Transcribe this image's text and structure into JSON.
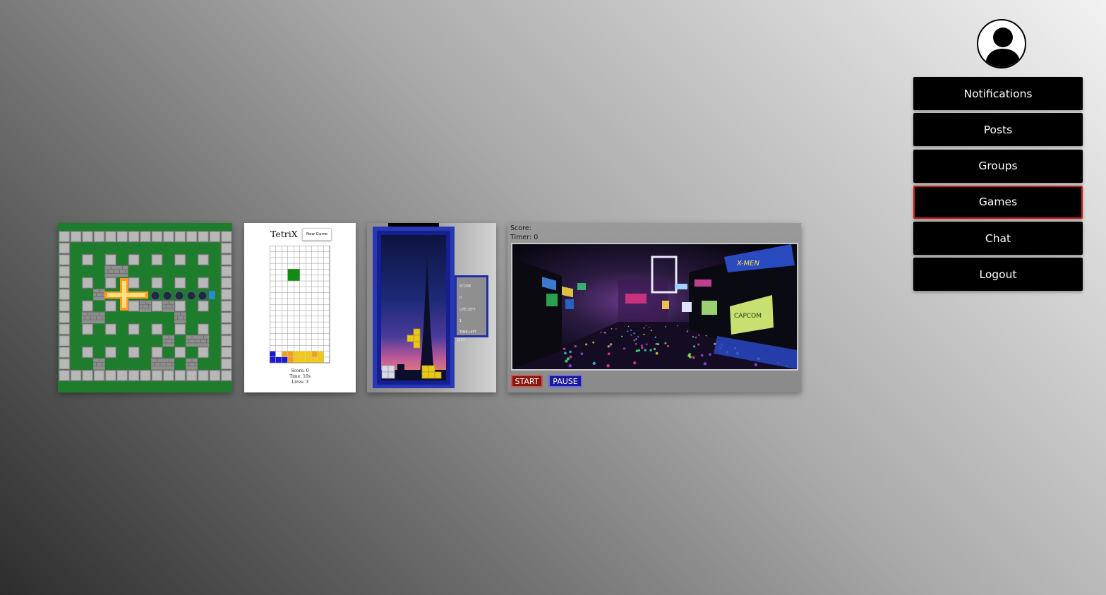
{
  "menu": {
    "items": [
      {
        "label": "Notifications",
        "name": "menu-item-notifications"
      },
      {
        "label": "Posts",
        "name": "menu-item-posts"
      },
      {
        "label": "Groups",
        "name": "menu-item-groups"
      },
      {
        "label": "Games",
        "name": "menu-item-games",
        "active": true
      },
      {
        "label": "Chat",
        "name": "menu-item-chat"
      },
      {
        "label": "Logout",
        "name": "menu-item-logout"
      }
    ],
    "active_border_color": "#d01818"
  },
  "games": {
    "tetrix": {
      "title": "TetriX",
      "new_game_label": "New Game",
      "score": "Score: 0",
      "time": "Time: 10s",
      "lives": "Lives: 3"
    },
    "skyline": {
      "score_label": "SCORE",
      "score_value": "0",
      "life_label": "LIFE LEFT",
      "life_value": "1",
      "time_label": "TIME LEFT",
      "time_value": "0:57"
    },
    "arcade": {
      "score_label": "Score:",
      "timer_label": "Timer: 0",
      "start_label": "START",
      "pause_label": "PAUSE",
      "screen_brand": "CAPCOM"
    }
  },
  "colors": {
    "bomber_grass": "#1e7d2c",
    "tetris_blue": "#1f2fa8",
    "tetris_yellow": "#e8c81a",
    "start_red": "#8b1710",
    "pause_blue": "#1a1a9a"
  }
}
